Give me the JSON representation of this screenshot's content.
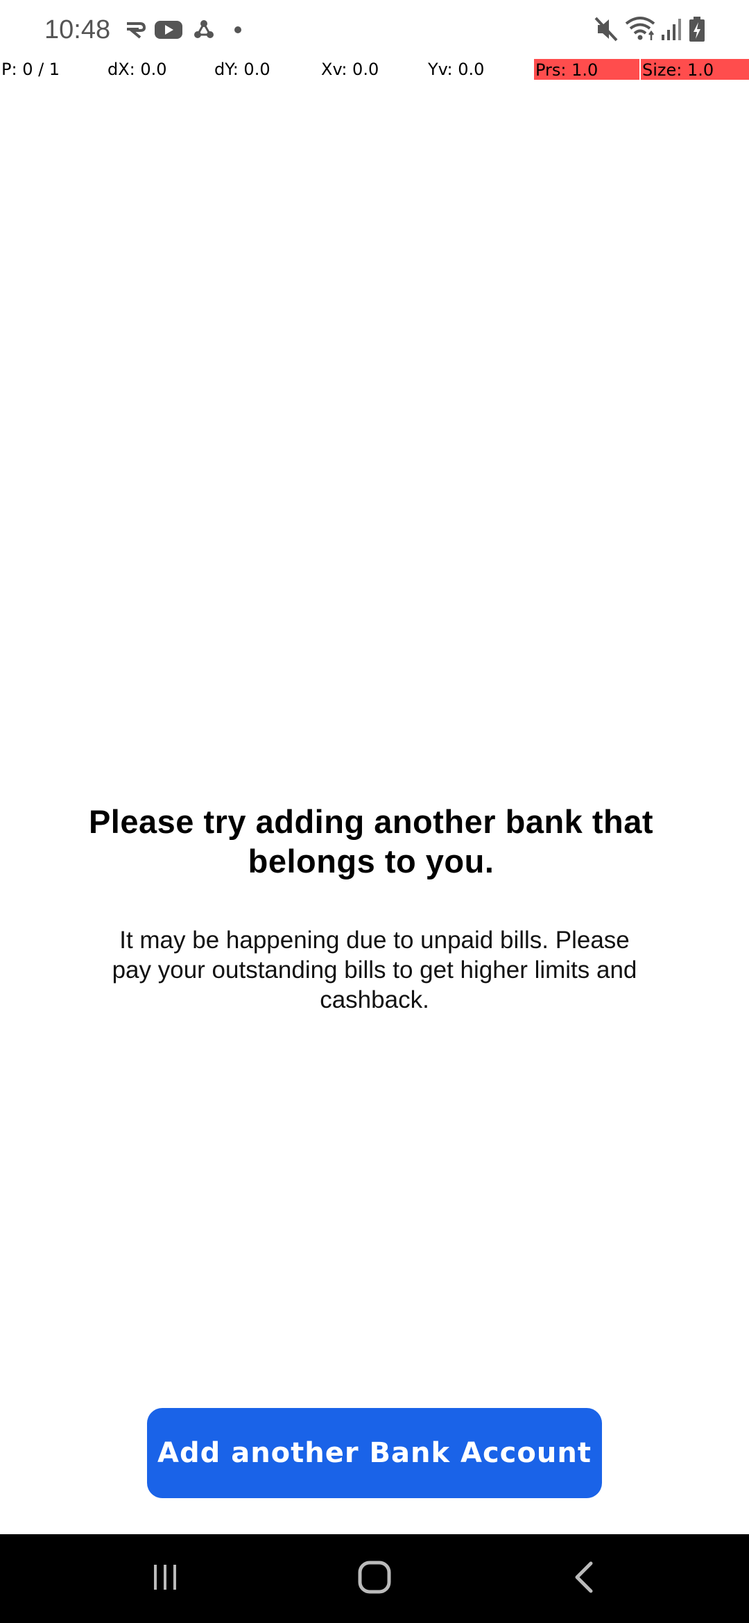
{
  "status_bar": {
    "time": "10:48",
    "icons": [
      "cast-icon",
      "youtube-icon",
      "app-notification-icon",
      "more-notifications-dot-icon",
      "mute-icon",
      "wifi-icon",
      "signal-icon",
      "battery-charging-icon"
    ]
  },
  "pointer_overlay": {
    "p": "P: 0 / 1",
    "dx": "dX: 0.0",
    "dy": "dY: 0.0",
    "xv": "Xv: 0.0",
    "yv": "Yv: 0.0",
    "prs": "Prs: 1.0",
    "size": "Size: 1.0",
    "highlight_color": "#ff4d4d"
  },
  "message": {
    "title": "Please try adding another bank that belongs to you.",
    "body": "It may be happening due to unpaid bills. Please pay your outstanding bills to get higher limits and cashback."
  },
  "primary_button": {
    "label": "Add another Bank Account",
    "color": "#1a63e8"
  },
  "nav_bar": {
    "items": [
      "recent-apps-icon",
      "home-icon",
      "back-icon"
    ]
  }
}
